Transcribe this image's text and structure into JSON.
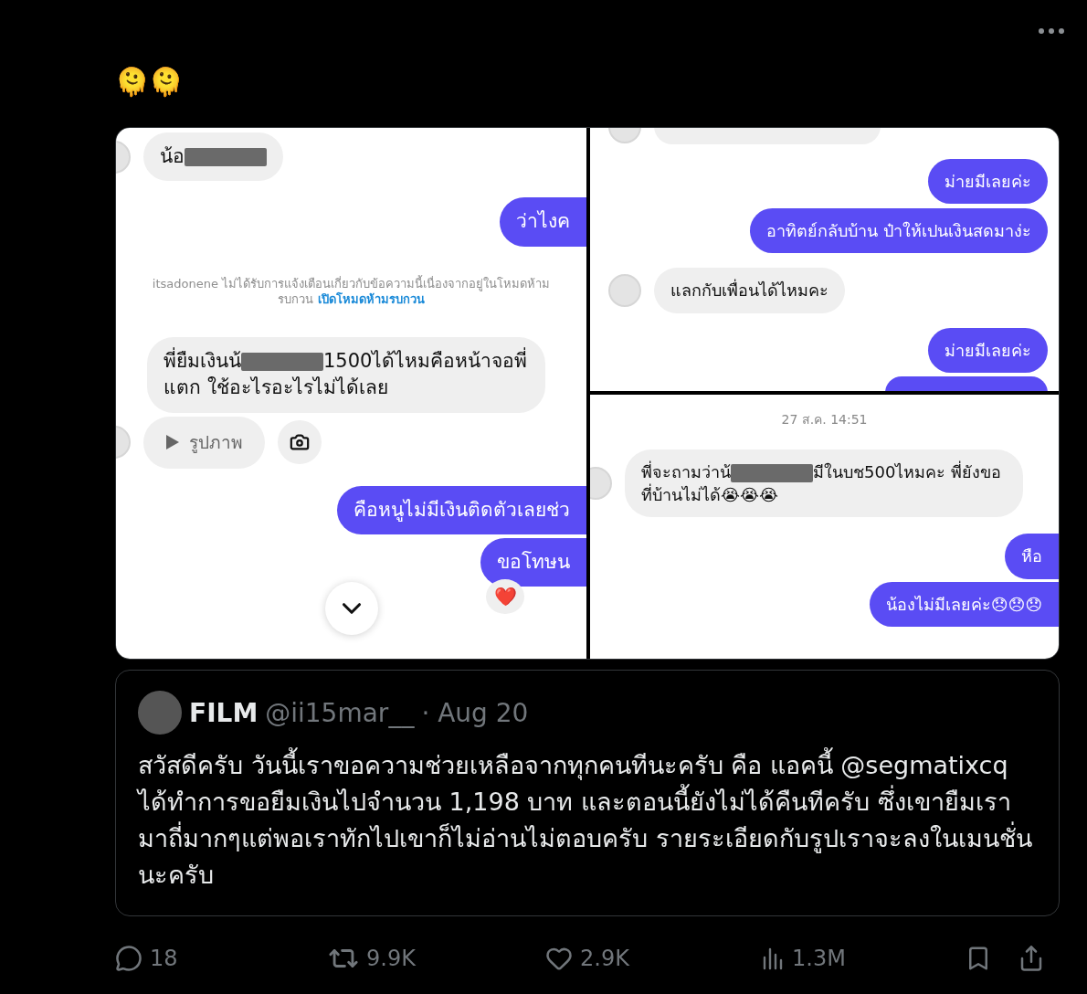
{
  "post": {
    "text": "🫠🫠"
  },
  "media": {
    "panels": [
      {
        "messages": [
          {
            "kind": "scroll-button"
          },
          {
            "kind": "received",
            "avatar": true,
            "clipped": false,
            "segments": [
              {
                "kind": "text",
                "text": "น้อ"
              },
              {
                "kind": "redaction"
              }
            ]
          },
          {
            "kind": "sent",
            "clipped": true,
            "segments": [
              {
                "kind": "text",
                "text": "ว่าไงค"
              }
            ]
          },
          {
            "kind": "notice",
            "text": "itsadonene ไม่ได้รับการแจ้งเตือนเกี่ยวกับข้อความนี้เนื่องจากอยู่ในโหมดห้าม รบกวน",
            "link": "เปิดโหมดห้ามรบกวน"
          },
          {
            "kind": "received",
            "avatar": false,
            "clipped": false,
            "segments": [
              {
                "kind": "text",
                "text": "พี่ยืมเงินน้"
              },
              {
                "kind": "redaction"
              },
              {
                "kind": "text",
                "text": "1500ได้ไหมคือหน้าจอพี่แตก ใช้อะไรอะไรไม่ได้เลย"
              }
            ]
          },
          {
            "kind": "attachment",
            "avatar": true,
            "label": "รูปภาพ"
          },
          {
            "kind": "sent",
            "clipped": true,
            "segments": [
              {
                "kind": "text",
                "text": "คือหนูไม่มีเงินติดตัวเลยช่ว"
              }
            ]
          },
          {
            "kind": "sent",
            "clipped": true,
            "reaction": "❤️",
            "segments": [
              {
                "kind": "text",
                "text": "ขอโทษน"
              }
            ]
          }
        ]
      },
      {
        "messages": [
          {
            "kind": "partial",
            "avatar": true
          },
          {
            "kind": "sent",
            "clipped": false,
            "segments": [
              {
                "kind": "text",
                "text": "ม่ายมีเลยค่ะ"
              }
            ]
          },
          {
            "kind": "sent",
            "clipped": false,
            "segments": [
              {
                "kind": "text",
                "text": "อาทิตย์กลับบ้าน ป๋าให้เปนเงินสดมาง่ะ"
              }
            ]
          },
          {
            "kind": "received",
            "avatar": true,
            "clipped": false,
            "segments": [
              {
                "kind": "text",
                "text": "แลกกับเพื่อนได้ไหมคะ"
              }
            ]
          },
          {
            "kind": "sent",
            "clipped": false,
            "segments": [
              {
                "kind": "text",
                "text": "ม่ายมีเลยค่ะ"
              }
            ]
          },
          {
            "kind": "partial-sent"
          }
        ]
      },
      {
        "messages": [
          {
            "kind": "timestamp",
            "text": "27 ส.ค. 14:51"
          },
          {
            "kind": "received",
            "avatar": true,
            "clipped": false,
            "segments": [
              {
                "kind": "text",
                "text": "พี่จะถามว่าน้"
              },
              {
                "kind": "redaction"
              },
              {
                "kind": "text",
                "text": "มีในบช500ไหมคะ พี่ยังขอที่บ้านไม่ได้😭😭😭"
              }
            ]
          },
          {
            "kind": "sent",
            "clipped": true,
            "segments": [
              {
                "kind": "text",
                "text": "หือ"
              }
            ]
          },
          {
            "kind": "sent",
            "clipped": true,
            "segments": [
              {
                "kind": "text",
                "text": "น้องไม่มีเลยค่ะ😞😞😞"
              }
            ]
          }
        ]
      }
    ]
  },
  "quote": {
    "name": "FILM",
    "handle": "@ii15mar__",
    "date": "· Aug 20",
    "text": "สวัสดีครับ วันนี้เราขอความช่วยเหลือจากทุกคนทีนะครับ คือ แอคนี้ @segmatixcq ได้ทำการขอยืมเงินไปจำนวน 1,198 บาท และตอนนี้ยังไม่ได้คืนทีครับ ซึ่งเขายืมเรามาถี่มากๆแต่พอเราทักไปเขาก็ไม่อ่านไม่ตอบครับ รายระเอียดกับรูปเราจะลงในเมนชั่นนะครับ"
  },
  "actions": [
    {
      "kind": "reply",
      "count": "18"
    },
    {
      "kind": "repost",
      "count": "9.9K"
    },
    {
      "kind": "like",
      "count": "2.9K"
    },
    {
      "kind": "views",
      "count": "1.3M"
    },
    {
      "kind": "bookmark"
    },
    {
      "kind": "share"
    }
  ]
}
